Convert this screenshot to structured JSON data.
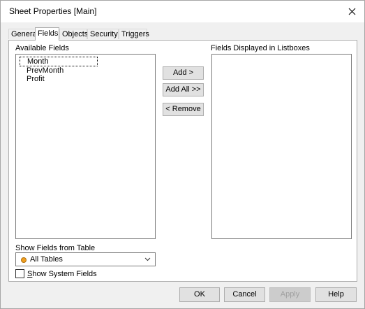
{
  "window": {
    "title": "Sheet Properties [Main]"
  },
  "tabs": [
    {
      "label": "General",
      "active": false
    },
    {
      "label": "Fields",
      "active": true
    },
    {
      "label": "Objects",
      "active": false
    },
    {
      "label": "Security",
      "active": false
    },
    {
      "label": "Triggers",
      "active": false
    }
  ],
  "fields_tab": {
    "available_fields_label": "Available Fields",
    "available_fields": [
      "Month",
      "PrevMonth",
      "Profit"
    ],
    "displayed_fields_label": "Fields Displayed in Listboxes",
    "displayed_fields": [],
    "add_label": "Add >",
    "add_all_label": "Add All >>",
    "remove_label": "< Remove",
    "show_fields_from_table_label": "Show Fields from Table",
    "table_select": {
      "value": "All Tables"
    },
    "show_system_fields": {
      "label_mnemonic": "S",
      "label_rest": "how System Fields",
      "checked": false
    }
  },
  "footer": {
    "ok_label": "OK",
    "cancel_label": "Cancel",
    "apply_label": "Apply",
    "help_label": "Help"
  },
  "colors": {
    "background": "#f0f0f0",
    "panel": "#ffffff",
    "button": "#e1e1e1",
    "table_dot": "#f0a020"
  }
}
